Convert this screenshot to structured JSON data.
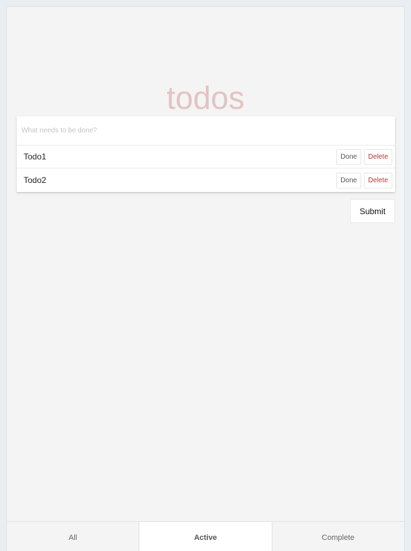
{
  "app": {
    "title": "todos"
  },
  "new_todo": {
    "placeholder": "What needs to be done?",
    "value": ""
  },
  "todos": [
    {
      "label": "Todo1",
      "done_label": "Done",
      "delete_label": "Delete"
    },
    {
      "label": "Todo2",
      "done_label": "Done",
      "delete_label": "Delete"
    }
  ],
  "actions": {
    "submit_label": "Submit"
  },
  "footer": {
    "tabs": [
      {
        "label": "All",
        "active": false
      },
      {
        "label": "Active",
        "active": true
      },
      {
        "label": "Complete",
        "active": false
      }
    ]
  },
  "colors": {
    "title": "#e6c3c3",
    "delete": "#b03a3a",
    "background": "#f4f4f4",
    "card": "#ffffff"
  }
}
